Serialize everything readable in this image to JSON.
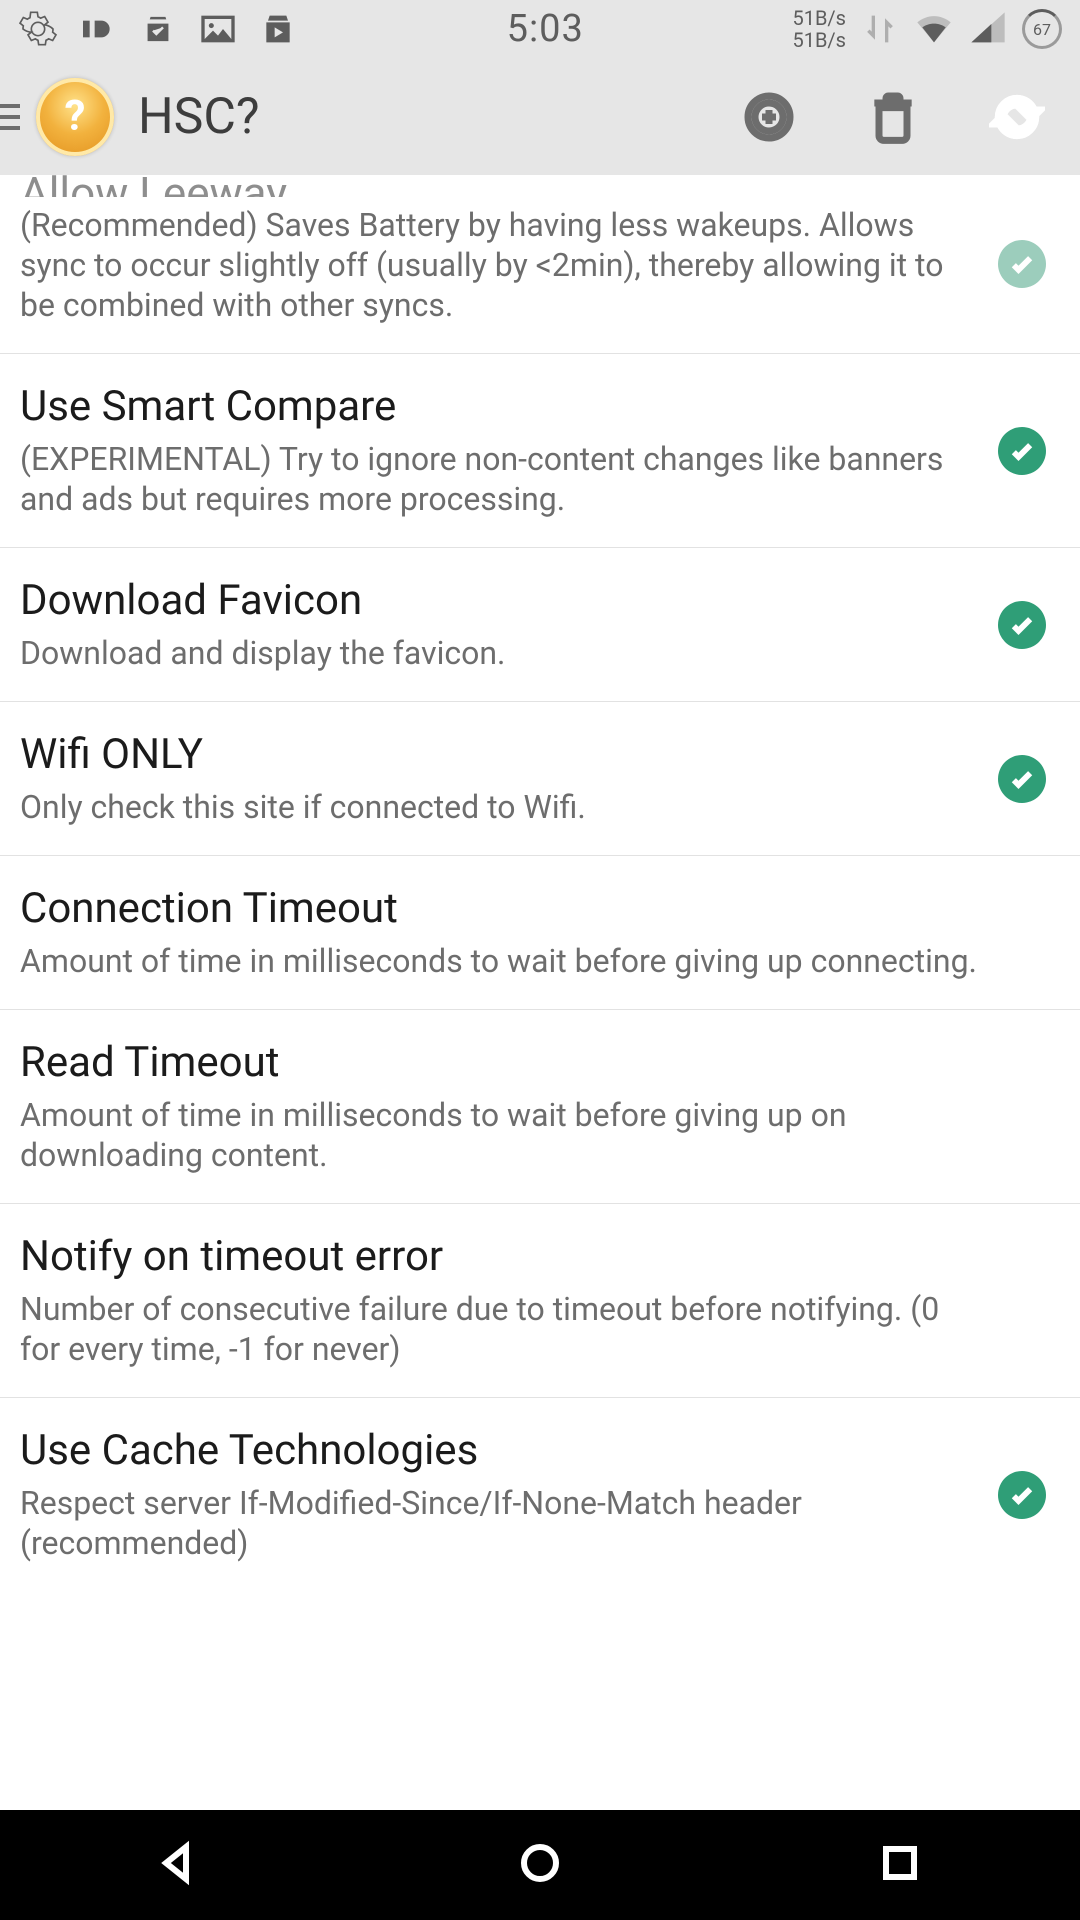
{
  "status": {
    "time": "5:03",
    "net_rate_down": "51B/s",
    "net_rate_up": "51B/s",
    "battery_pct": "67"
  },
  "appbar": {
    "title": "HSC?"
  },
  "settings": [
    {
      "title": "Allow Leeway",
      "sub": "(Recommended) Saves Battery by having less wakeups.\nAllows sync to occur slightly off (usually by <2min), thereby allowing it to be combined with other syncs.",
      "checked": true,
      "dim": true
    },
    {
      "title": "Use Smart Compare",
      "sub": "(EXPERIMENTAL) Try to ignore non-content changes like banners and ads but requires more processing.",
      "checked": true
    },
    {
      "title": "Download Favicon",
      "sub": "Download and display the favicon.",
      "checked": true
    },
    {
      "title": "Wifi ONLY",
      "sub": "Only check this site if connected to Wifi.",
      "checked": true
    },
    {
      "title": "Connection Timeout",
      "sub": "Amount of time in milliseconds to wait before giving up connecting.",
      "checked": false
    },
    {
      "title": "Read Timeout",
      "sub": "Amount of time in milliseconds to wait before giving up on downloading content.",
      "checked": false
    },
    {
      "title": "Notify on timeout error",
      "sub": "Number of consecutive failure due to timeout before notifying. (0 for every time, -1 for never)",
      "checked": false
    },
    {
      "title": "Use Cache Technologies",
      "sub": "Respect server If-Modified-Since/If-None-Match header (recommended)",
      "checked": true
    }
  ]
}
